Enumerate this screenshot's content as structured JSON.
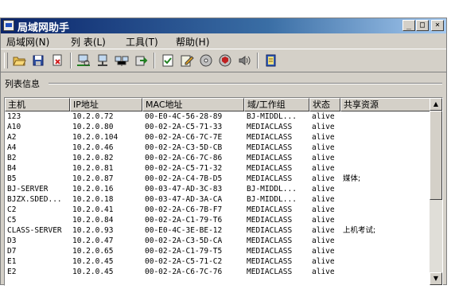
{
  "window": {
    "title": "局域网助手"
  },
  "title_buttons": {
    "minimize": "_",
    "maximize": "□",
    "close": "×"
  },
  "menu": [
    "局域网(N)",
    "列 表(L)",
    "工具(T)",
    "帮助(H)"
  ],
  "toolbar_icons": [
    "open-folder-icon",
    "save-icon",
    "close-file-icon",
    "scan-network-icon",
    "computer-network-icon",
    "network-group-icon",
    "export-icon",
    "check-icon",
    "edit-icon",
    "disk-icon",
    "shield-disk-icon",
    "speaker-icon",
    "help-book-icon"
  ],
  "group_label": "列表信息",
  "columns": [
    "主机",
    "IP地址",
    "MAC地址",
    "域/工作组",
    "状态",
    "共享资源"
  ],
  "rows": [
    {
      "host": "123",
      "ip": "10.2.0.72",
      "mac": "00-E0-4C-56-28-89",
      "group": "BJ-MIDDL...",
      "status": "alive",
      "share": ""
    },
    {
      "host": "A10",
      "ip": "10.2.0.80",
      "mac": "00-02-2A-C5-71-33",
      "group": "MEDIACLASS",
      "status": "alive",
      "share": ""
    },
    {
      "host": "A2",
      "ip": "10.2.0.104",
      "mac": "00-02-2A-C6-7C-7E",
      "group": "MEDIACLASS",
      "status": "alive",
      "share": ""
    },
    {
      "host": "A4",
      "ip": "10.2.0.46",
      "mac": "00-02-2A-C3-5D-CB",
      "group": "MEDIACLASS",
      "status": "alive",
      "share": ""
    },
    {
      "host": "B2",
      "ip": "10.2.0.82",
      "mac": "00-02-2A-C6-7C-86",
      "group": "MEDIACLASS",
      "status": "alive",
      "share": ""
    },
    {
      "host": "B4",
      "ip": "10.2.0.81",
      "mac": "00-02-2A-C5-71-32",
      "group": "MEDIACLASS",
      "status": "alive",
      "share": ""
    },
    {
      "host": "B5",
      "ip": "10.2.0.87",
      "mac": "00-02-2A-C4-7B-D5",
      "group": "MEDIACLASS",
      "status": "alive",
      "share": "媒体;"
    },
    {
      "host": "BJ-SERVER",
      "ip": "10.2.0.16",
      "mac": "00-03-47-AD-3C-83",
      "group": "BJ-MIDDL...",
      "status": "alive",
      "share": ""
    },
    {
      "host": "BJZX.SDED...",
      "ip": "10.2.0.18",
      "mac": "00-03-47-AD-3A-CA",
      "group": "BJ-MIDDL...",
      "status": "alive",
      "share": ""
    },
    {
      "host": "C2",
      "ip": "10.2.0.41",
      "mac": "00-02-2A-C6-7B-F7",
      "group": "MEDIACLASS",
      "status": "alive",
      "share": ""
    },
    {
      "host": "C5",
      "ip": "10.2.0.84",
      "mac": "00-02-2A-C1-79-T6",
      "group": "MEDIACLASS",
      "status": "alive",
      "share": ""
    },
    {
      "host": "CLASS-SERVER",
      "ip": "10.2.0.93",
      "mac": "00-E0-4C-3E-BE-12",
      "group": "MEDIACLASS",
      "status": "alive",
      "share": "上机考试;"
    },
    {
      "host": "D3",
      "ip": "10.2.0.47",
      "mac": "00-02-2A-C3-5D-CA",
      "group": "MEDIACLASS",
      "status": "alive",
      "share": ""
    },
    {
      "host": "D7",
      "ip": "10.2.0.65",
      "mac": "00-02-2A-C1-79-T5",
      "group": "MEDIACLASS",
      "status": "alive",
      "share": ""
    },
    {
      "host": "E1",
      "ip": "10.2.0.45",
      "mac": "00-02-2A-C5-71-C2",
      "group": "MEDIACLASS",
      "status": "alive",
      "share": ""
    },
    {
      "host": "E2",
      "ip": "10.2.0.45",
      "mac": "00-02-2A-C6-7C-76",
      "group": "MEDIACLASS",
      "status": "alive",
      "share": ""
    }
  ],
  "scrollbar": {
    "up_arrow": "▲",
    "down_arrow": "▼"
  },
  "colors": {
    "titlebar": "#0a246a",
    "face": "#d4d0c8"
  }
}
